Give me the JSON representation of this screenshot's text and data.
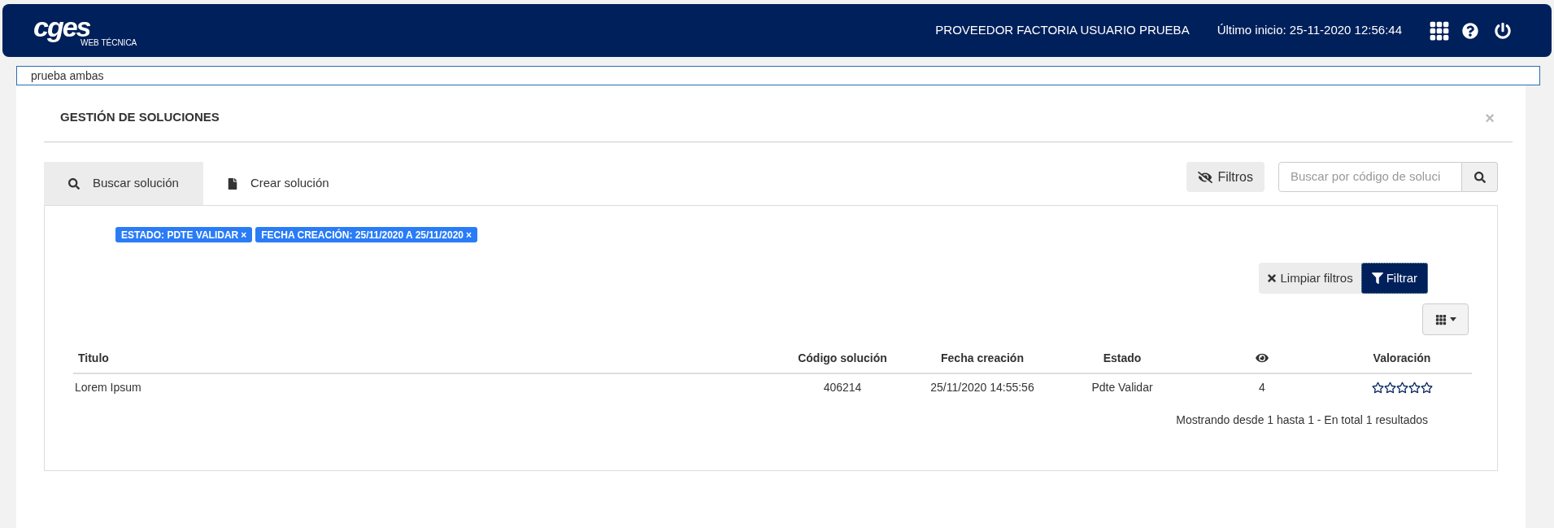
{
  "header": {
    "logo": "cges",
    "logo_subtitle": "WEB TÉCNICA",
    "user": "PROVEEDOR FACTORIA USUARIO PRUEBA",
    "last_login": "Último inicio: 25-11-2020 12:56:44"
  },
  "notice": {
    "value": "prueba ambas"
  },
  "panel": {
    "title": "GESTIÓN DE SOLUCIONES",
    "close": "×"
  },
  "tabs": [
    {
      "label": "Buscar solución",
      "selected": true
    },
    {
      "label": "Crear solución",
      "selected": false
    }
  ],
  "filters_button": "Filtros",
  "search": {
    "placeholder": "Buscar por código de soluci"
  },
  "chips": [
    {
      "label": "ESTADO: PDTE VALIDAR",
      "remove": "×"
    },
    {
      "label": "FECHA CREACIÓN: 25/11/2020 A 25/11/2020",
      "remove": "×"
    }
  ],
  "actions": {
    "clear": "Limpiar filtros",
    "apply": "Filtrar"
  },
  "table": {
    "columns": [
      {
        "kind": "text",
        "label": "Titulo"
      },
      {
        "kind": "text",
        "label": "Código solución"
      },
      {
        "kind": "text",
        "label": "Fecha creación"
      },
      {
        "kind": "text",
        "label": "Estado"
      },
      {
        "kind": "eye"
      },
      {
        "kind": "text",
        "label": "Valoración"
      }
    ],
    "rows": [
      {
        "cells": [
          "Lorem Ipsum",
          "406214",
          "25/11/2020 14:55:56",
          "Pdte Validar",
          "4"
        ],
        "stars": 0
      }
    ]
  },
  "footer": "Mostrando desde 1 hasta 1 - En total 1 resultados"
}
